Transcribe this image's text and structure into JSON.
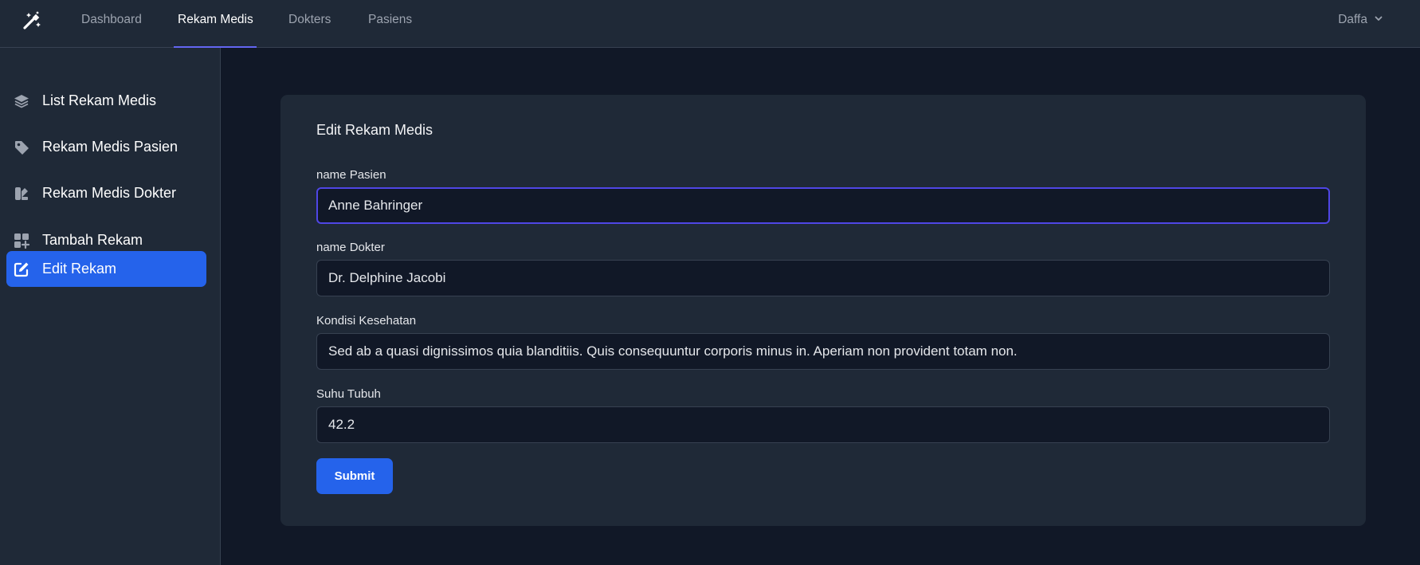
{
  "topnav": {
    "logo_icon": "magic-wand-icon",
    "links": [
      {
        "label": "Dashboard",
        "active": false
      },
      {
        "label": "Rekam Medis",
        "active": true
      },
      {
        "label": "Dokters",
        "active": false
      },
      {
        "label": "Pasiens",
        "active": false
      }
    ],
    "user": {
      "name": "Daffa",
      "icon": "chevron-down-icon"
    },
    "accent": "#6366f1"
  },
  "sidebar": {
    "items": [
      {
        "label": "List Rekam Medis",
        "icon": "layers-icon",
        "active": false
      },
      {
        "label": "Rekam Medis Pasien",
        "icon": "tag-icon",
        "active": false
      },
      {
        "label": "Rekam Medis Dokter",
        "icon": "swatch-icon",
        "active": false
      },
      {
        "label": "Tambah Rekam",
        "icon": "grid-plus-icon",
        "active": false
      },
      {
        "label": "Edit Rekam",
        "icon": "edit-icon",
        "active": true
      }
    ],
    "active_color": "#2563eb"
  },
  "form": {
    "title": "Edit Rekam Medis",
    "fields": [
      {
        "label": "name Pasien",
        "value": "Anne Bahringer"
      },
      {
        "label": "name Dokter",
        "value": "Dr. Delphine Jacobi"
      },
      {
        "label": "Kondisi Kesehatan",
        "value": "Sed ab a quasi dignissimos quia blanditiis. Quis consequuntur corporis minus in. Aperiam non provident totam non."
      },
      {
        "label": "Suhu Tubuh",
        "value": "42.2"
      }
    ],
    "submit_label": "Submit"
  }
}
